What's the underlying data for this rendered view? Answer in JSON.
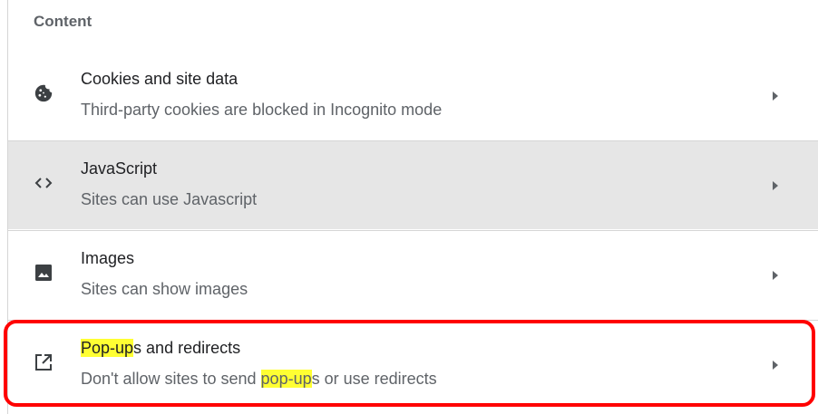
{
  "section": {
    "title": "Content"
  },
  "rows": [
    {
      "icon": "cookie-icon",
      "title": "Cookies and site data",
      "subtitle": "Third-party cookies are blocked in Incognito mode"
    },
    {
      "icon": "code-brackets-icon",
      "title": "JavaScript",
      "subtitle": "Sites can use Javascript"
    },
    {
      "icon": "image-icon",
      "title": "Images",
      "subtitle": "Sites can show images"
    },
    {
      "icon": "open-in-new-icon",
      "title_highlight": "Pop-up",
      "title_rest": "s and redirects",
      "subtitle_pre": "Don't allow sites to send ",
      "subtitle_highlight": "pop-up",
      "subtitle_post": "s or use redirects"
    }
  ],
  "colors": {
    "highlight": "#ffff33",
    "annotation_box": "#ff0000",
    "hover_row": "#e6e6e6"
  }
}
